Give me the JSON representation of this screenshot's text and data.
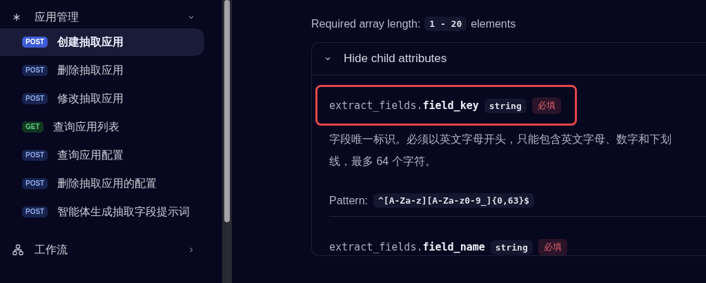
{
  "sidebar": {
    "section": {
      "label": "应用管理",
      "expanded": true
    },
    "items": [
      {
        "method": "POST",
        "label": "创建抽取应用",
        "selected": true
      },
      {
        "method": "POST",
        "label": "删除抽取应用",
        "selected": false
      },
      {
        "method": "POST",
        "label": "修改抽取应用",
        "selected": false
      },
      {
        "method": "GET",
        "label": "查询应用列表",
        "selected": false
      },
      {
        "method": "POST",
        "label": "查询应用配置",
        "selected": false
      },
      {
        "method": "POST",
        "label": "删除抽取应用的配置",
        "selected": false
      },
      {
        "method": "POST",
        "label": "智能体生成抽取字段提示词",
        "selected": false
      }
    ],
    "next_section": {
      "label": "工作流",
      "expanded": false
    }
  },
  "content": {
    "length_label": "Required array length:",
    "length_value": "1 - 20",
    "length_suffix": "elements",
    "card": {
      "toggle_label": "Hide child attributes",
      "expanded": true,
      "fields": [
        {
          "prefix": "extract_fields.",
          "name": "field_key",
          "type": "string",
          "badge": "必填",
          "highlighted": true,
          "description": "字段唯一标识。必须以英文字母开头，只能包含英文字母、数字和下划线，最多 64 个字符。",
          "pattern_label": "Pattern:",
          "pattern": "^[A-Za-z][A-Za-z0-9_]{0,63}$"
        },
        {
          "prefix": "extract_fields.",
          "name": "field_name",
          "type": "string",
          "badge": "必填",
          "highlighted": false
        }
      ]
    }
  }
}
